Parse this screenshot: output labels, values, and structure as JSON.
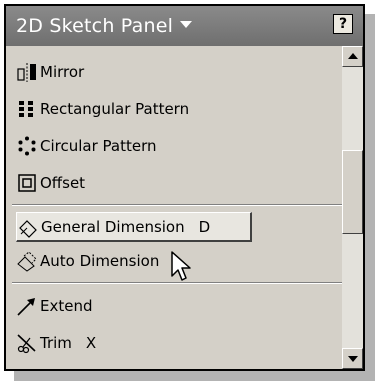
{
  "panel": {
    "title": "2D Sketch Panel",
    "help_label": "?"
  },
  "items": [
    {
      "label": "Mirror",
      "icon": "mirror-icon"
    },
    {
      "label": "Rectangular Pattern",
      "icon": "rectangular-pattern-icon"
    },
    {
      "label": "Circular Pattern",
      "icon": "circular-pattern-icon"
    },
    {
      "label": "Offset",
      "icon": "offset-icon"
    },
    {
      "label": "General Dimension",
      "shortcut": "D",
      "icon": "dimension-icon"
    },
    {
      "label": "Auto Dimension",
      "icon": "auto-dimension-icon"
    },
    {
      "label": "Extend",
      "icon": "extend-icon"
    },
    {
      "label": "Trim",
      "shortcut": "X",
      "icon": "trim-icon"
    }
  ]
}
